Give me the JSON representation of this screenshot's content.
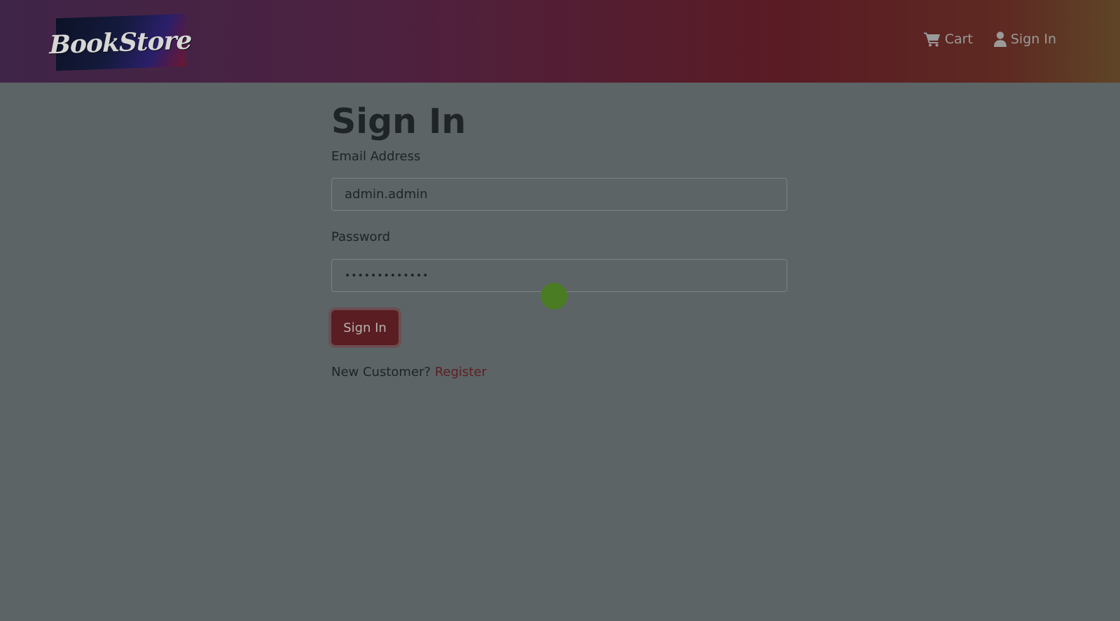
{
  "header": {
    "logo_text": "BookStore",
    "cart_label": "Cart",
    "signin_label": "Sign In",
    "cart_icon": "shopping-cart-icon",
    "user_icon": "user-icon"
  },
  "form": {
    "title": "Sign In",
    "email_label": "Email Address",
    "email_value": "admin.admin",
    "password_label": "Password",
    "password_value": "•••••••••••••",
    "submit_label": "Sign In",
    "new_customer_text": "New Customer?",
    "register_label": "Register"
  },
  "colors": {
    "overlay_background": "#5c6466",
    "accent": "#5a1d21",
    "cursor_indicator": "#4a7d23"
  }
}
